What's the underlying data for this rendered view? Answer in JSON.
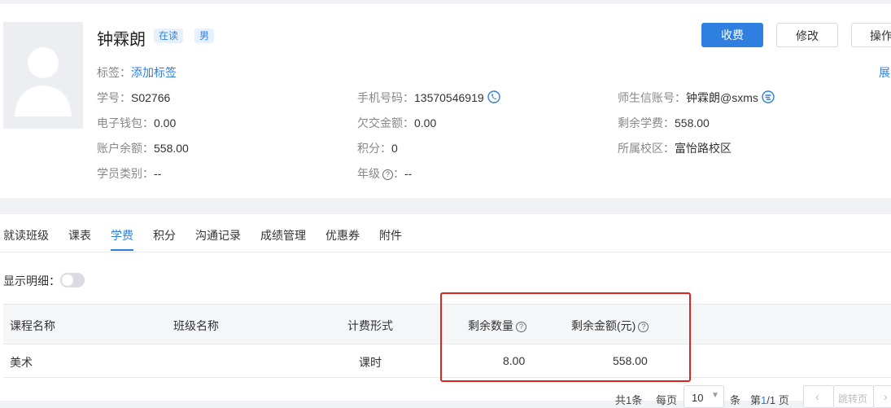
{
  "student": {
    "name": "钟霖朗",
    "status_tag": "在读",
    "gender_tag": "男"
  },
  "actions": {
    "charge": "收费",
    "edit": "修改",
    "operate": "操作"
  },
  "expand_link": "展",
  "tags_row": {
    "label": "标签：",
    "action": "添加标签"
  },
  "fields": {
    "student_no": {
      "label": "学号：",
      "value": "S02766"
    },
    "phone": {
      "label": "手机号码：",
      "value": "13570546919"
    },
    "account": {
      "label": "师生信账号：",
      "value": "钟霖朗@sxms"
    },
    "wallet": {
      "label": "电子钱包：",
      "value": "0.00"
    },
    "owed": {
      "label": "欠交金额：",
      "value": "0.00"
    },
    "remaining_fee": {
      "label": "剩余学费：",
      "value": "558.00"
    },
    "balance": {
      "label": "账户余额：",
      "value": "558.00"
    },
    "points": {
      "label": "积分：",
      "value": "0"
    },
    "campus": {
      "label": "所属校区：",
      "value": "富怡路校区"
    },
    "category": {
      "label": "学员类别：",
      "value": "--"
    },
    "grade": {
      "label": "年级",
      "suffix": "：",
      "value": "--"
    }
  },
  "tabs": [
    "就读班级",
    "课表",
    "学费",
    "积分",
    "沟通记录",
    "成绩管理",
    "优惠券",
    "附件"
  ],
  "active_tab": "学费",
  "detail_toggle": {
    "label": "显示明细：",
    "on": false
  },
  "table": {
    "headers": [
      "课程名称",
      "班级名称",
      "计费形式",
      "剩余数量",
      "剩余金额(元)"
    ],
    "rows": [
      [
        "美术",
        "",
        "课时",
        "8.00",
        "558.00"
      ]
    ]
  },
  "pager": {
    "total_text": "共1条",
    "per_page_label": "每页",
    "page_size": "10",
    "unit": "条",
    "page_text_prefix": "第",
    "current_page": "1",
    "page_text_suffix": "/1 页",
    "jump": "跳转页"
  },
  "colors": {
    "primary": "#2f7fe0",
    "highlight": "#e0231c"
  }
}
